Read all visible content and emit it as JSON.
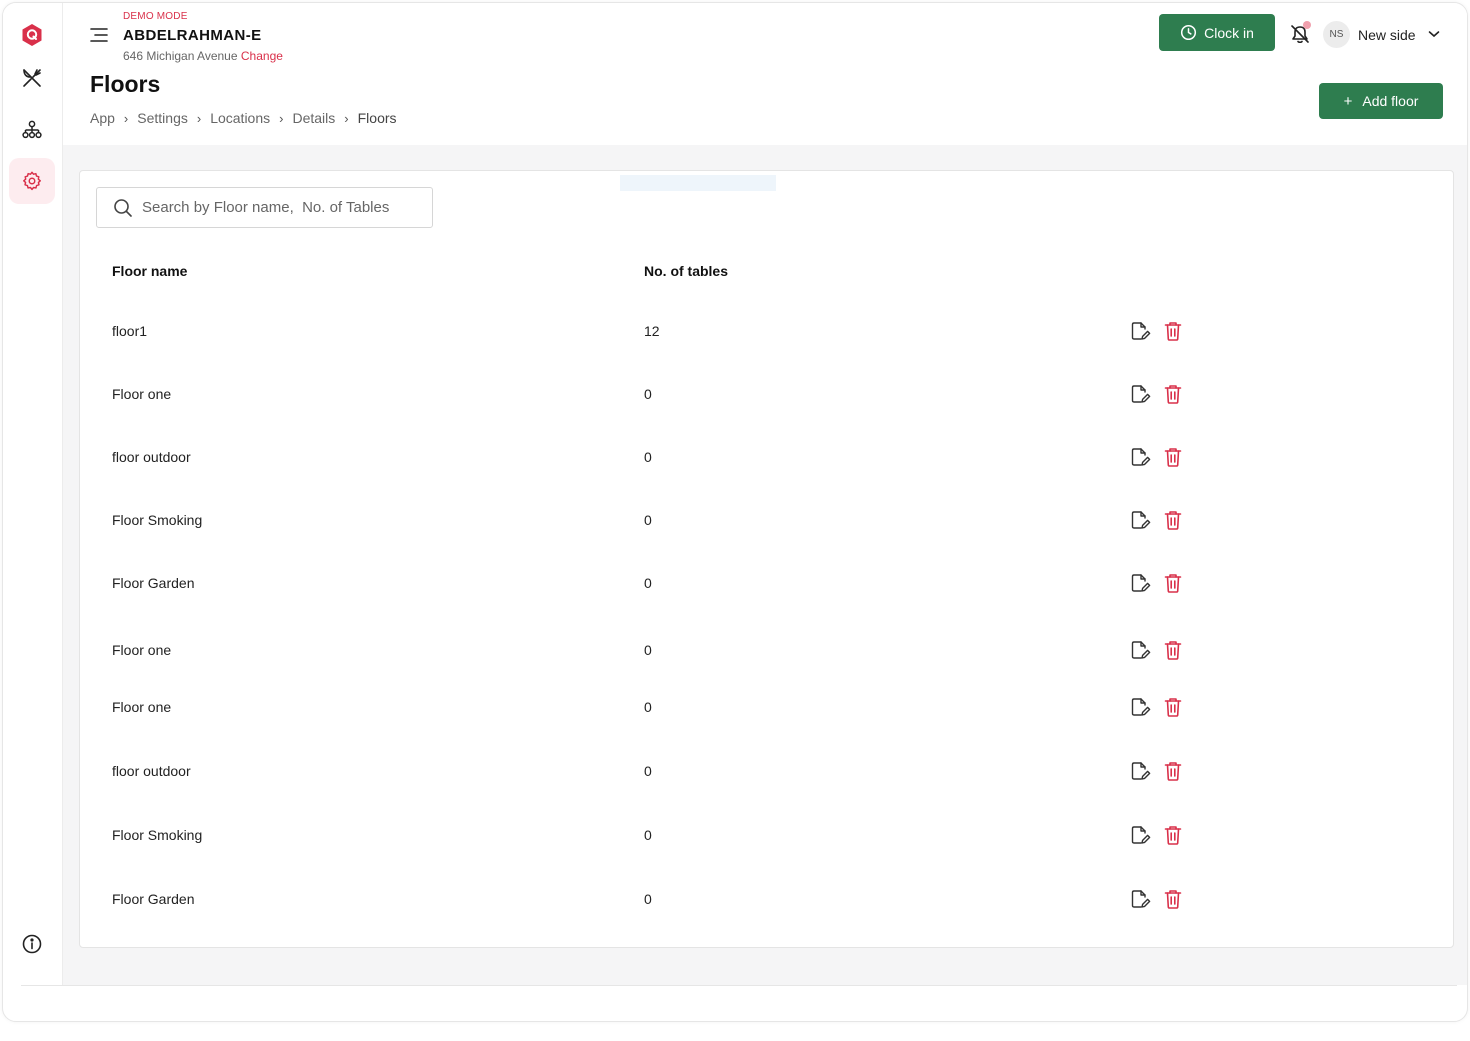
{
  "app": {
    "demo_mode": "DEMO MODE",
    "store_name": "ABDELRAHMAN-E",
    "address": "646 Michigan Avenue",
    "change_label": "Change"
  },
  "sidebar": {
    "items": [
      {
        "name": "logo",
        "icon": "logo-icon"
      },
      {
        "name": "menu",
        "icon": "utensils-icon"
      },
      {
        "name": "organization",
        "icon": "hierarchy-icon"
      },
      {
        "name": "settings",
        "icon": "gear-icon",
        "active": true
      },
      {
        "name": "info",
        "icon": "info-icon"
      }
    ]
  },
  "header": {
    "title": "Floors",
    "breadcrumb": [
      "App",
      "Settings",
      "Locations",
      "Details",
      "Floors"
    ],
    "clock_in_label": "Clock in",
    "user_initials": "NS",
    "user_name": "New side",
    "add_label": "Add floor"
  },
  "search": {
    "placeholder": "Search by Floor name,  No. of Tables",
    "value": ""
  },
  "table": {
    "columns": [
      "Floor name",
      "No. of tables"
    ],
    "rows": [
      {
        "name": "floor1",
        "count": "12"
      },
      {
        "name": "Floor one",
        "count": "0"
      },
      {
        "name": "floor outdoor",
        "count": "0"
      },
      {
        "name": "Floor Smoking",
        "count": "0"
      },
      {
        "name": "Floor Garden",
        "count": "0"
      },
      {
        "name": "Floor one",
        "count": "0"
      },
      {
        "name": "Floor one",
        "count": "0"
      },
      {
        "name": "floor outdoor",
        "count": "0"
      },
      {
        "name": "Floor Smoking",
        "count": "0"
      },
      {
        "name": "Floor Garden",
        "count": "0"
      }
    ]
  },
  "colors": {
    "primary": "#2e7d4f",
    "accent": "#d9304a",
    "active_bg": "#fdecef"
  }
}
